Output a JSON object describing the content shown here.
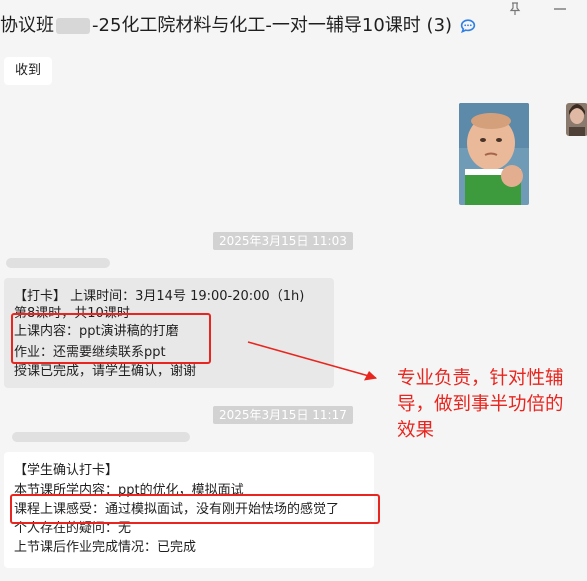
{
  "window": {
    "title_prefix": "协议班",
    "title_main": "-25化工院材料与化工-一对一辅导10课时",
    "member_count": "(3)"
  },
  "colors": {
    "highlight_red": "#e8261f",
    "bubble_gray": "#e8e8e8",
    "bubble_white": "#ffffff",
    "background": "#f5f5f5"
  },
  "messages": {
    "received_reply": "收到",
    "timestamp_1": "2025年3月15日 11:03",
    "timestamp_2": "2025年3月15日 11:17",
    "teacher_checkin": {
      "line1": "【打卡】 上课时间：3月14号 19:00-20:00（1h)",
      "line2": "第8课时，共10课时",
      "line3": "上课内容：ppt演讲稿的打磨",
      "line4": "作业：还需要继续联系ppt",
      "line5": "授课已完成，请学生确认，谢谢"
    },
    "student_confirm": {
      "line1": "【学生确认打卡】",
      "line2": "本节课所学内容：ppt的优化，模拟面试",
      "line3": "课程上课感受：通过模拟面试，没有刚开始怯场的感觉了",
      "line4": "个人存在的疑问：无",
      "line5": "上节课后作业完成情况：已完成"
    }
  },
  "annotation": {
    "line1": "专业负责，针对性辅",
    "line2": "导，做到事半功倍的",
    "line3": "效果"
  },
  "icons": {
    "pin": "pin-icon",
    "minimize": "minimize-icon",
    "chat": "chat-bubble-icon"
  }
}
